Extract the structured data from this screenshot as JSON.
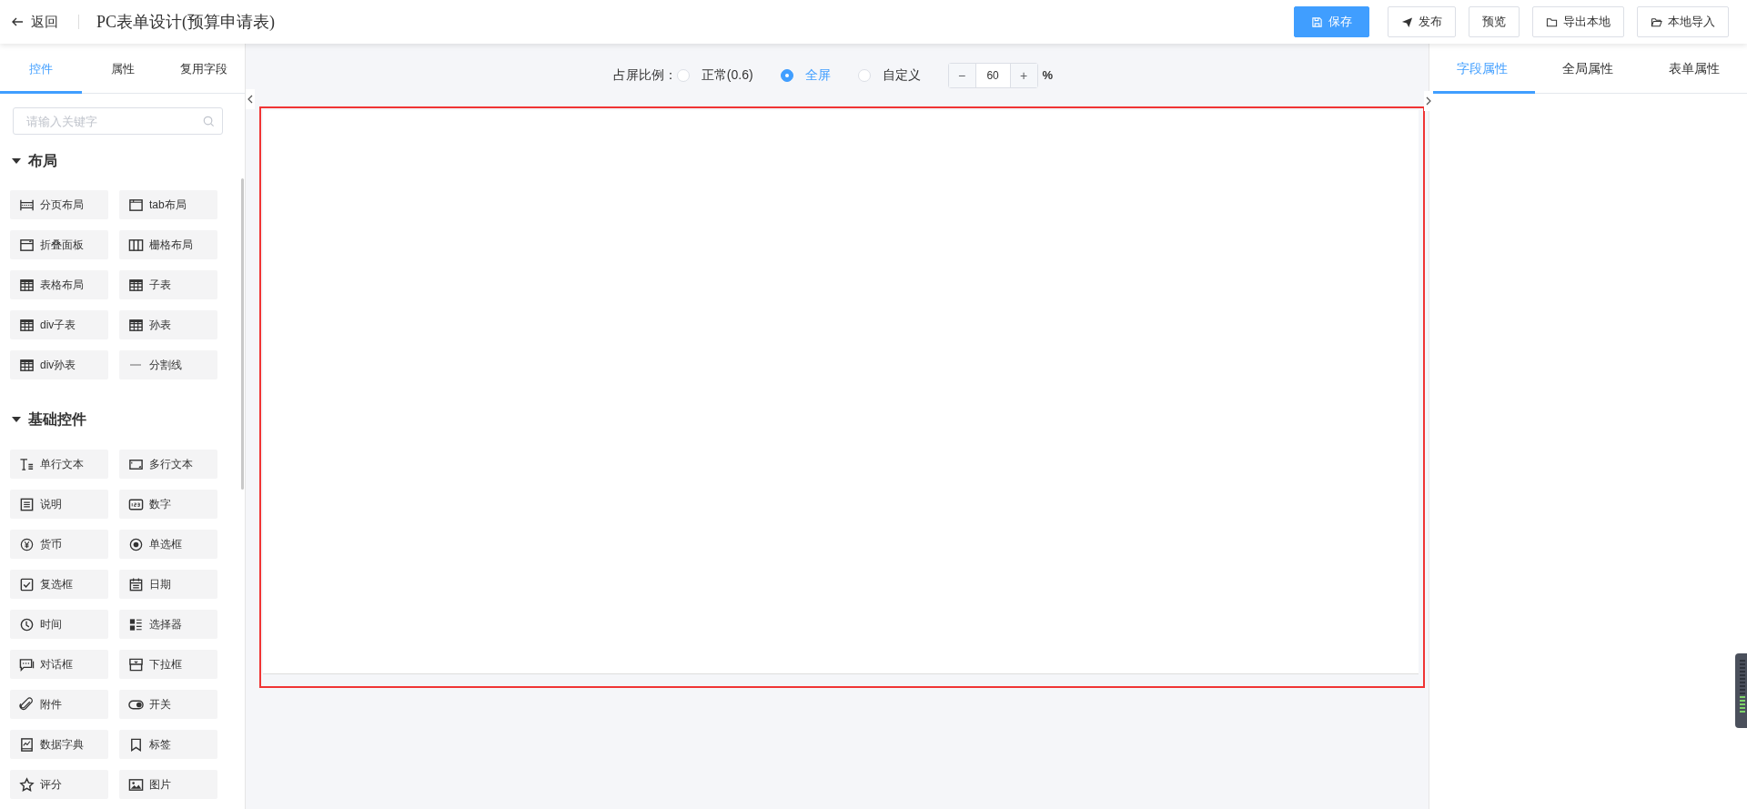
{
  "header": {
    "back": "返回",
    "title": "PC表单设计(预算申请表)",
    "buttons": [
      {
        "label": "保存",
        "kind": "primary"
      },
      {
        "label": "发布",
        "kind": "default"
      },
      {
        "label": "预览",
        "kind": "default"
      },
      {
        "label": "导出本地",
        "kind": "default"
      },
      {
        "label": "本地导入",
        "kind": "default"
      }
    ]
  },
  "left_panel": {
    "tabs": [
      {
        "label": "控件",
        "selected": true
      },
      {
        "label": "属性",
        "selected": false
      },
      {
        "label": "复用字段",
        "selected": false
      }
    ],
    "search": {
      "placeholder": "请输入关键字"
    },
    "groups": [
      {
        "title": "布局",
        "expanded": true,
        "items": [
          "分页布局",
          "tab布局",
          "折叠面板",
          "栅格布局",
          "表格布局",
          "子表",
          "div子表",
          "孙表",
          "div孙表",
          "分割线"
        ]
      },
      {
        "title": "基础控件",
        "expanded": true,
        "items": [
          "单行文本",
          "多行文本",
          "说明",
          "数字",
          "货币",
          "单选框",
          "复选框",
          "日期",
          "时间",
          "选择器",
          "对话框",
          "下拉框",
          "附件",
          "开关",
          "数据字典",
          "标签",
          "评分",
          "图片"
        ]
      }
    ]
  },
  "toolbar": {
    "label": "占屏比例：",
    "options": [
      {
        "label": "正常(0.6)",
        "selected": false
      },
      {
        "label": "全屏",
        "selected": true
      },
      {
        "label": "自定义",
        "selected": false
      }
    ],
    "stepper": {
      "minus": "−",
      "value": "60",
      "plus": "+",
      "unit": "%"
    }
  },
  "right_panel": {
    "tabs": [
      {
        "label": "字段属性",
        "selected": true
      },
      {
        "label": "全局属性",
        "selected": false
      },
      {
        "label": "表单属性",
        "selected": false
      }
    ]
  }
}
